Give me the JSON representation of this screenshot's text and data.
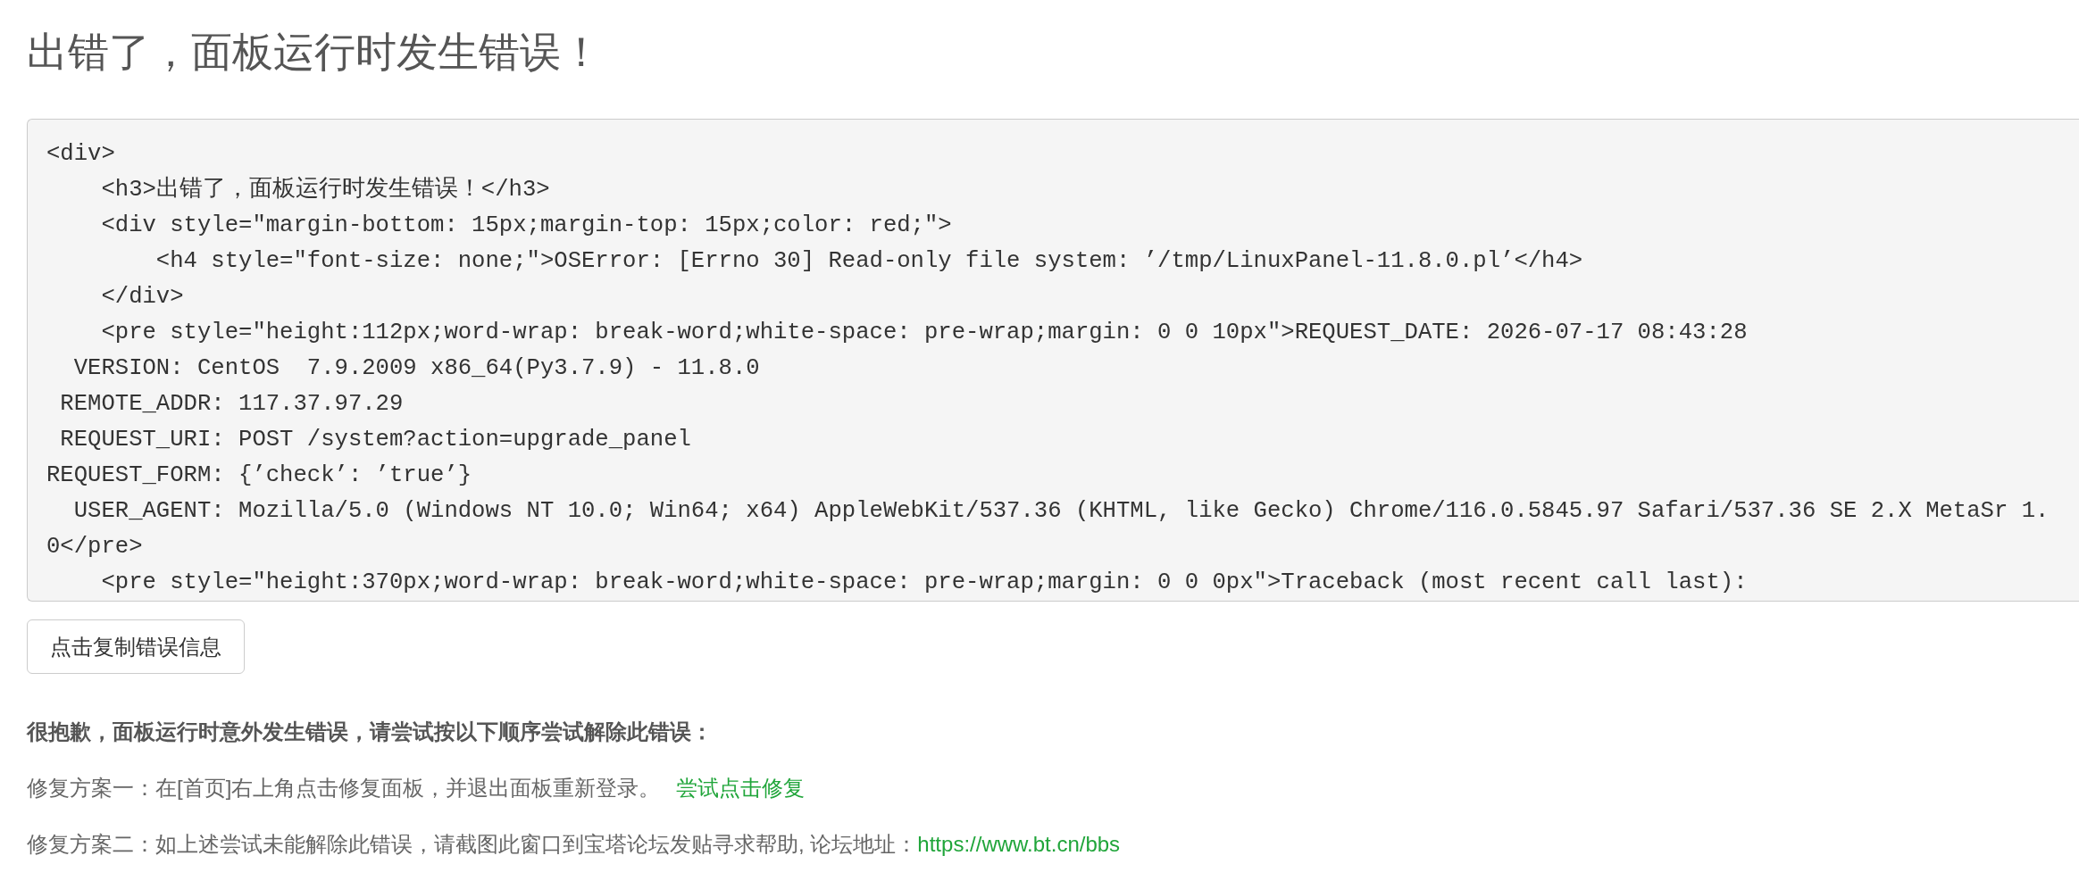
{
  "page": {
    "title": "出错了，面板运行时发生错误！"
  },
  "error_details": {
    "lines": [
      "<div>",
      "    <h3>出错了，面板运行时发生错误！</h3>",
      "    <div style=\"margin-bottom: 15px;margin-top: 15px;color: red;\">",
      "        <h4 style=\"font-size: none;\">OSError: [Errno 30] Read-only file system: ’/tmp/LinuxPanel-11.8.0.pl’</h4>",
      "    </div>",
      "    <pre style=\"height:112px;word-wrap: break-word;white-space: pre-wrap;margin: 0 0 10px\">REQUEST_DATE: 2026-07-17 08:43:28",
      "  VERSION: CentOS  7.9.2009 x86_64(Py3.7.9) - 11.8.0",
      " REMOTE_ADDR: 117.37.97.29",
      " REQUEST_URI: POST /system?action=upgrade_panel",
      "REQUEST_FORM: {’check’: ’true’}",
      "  USER_AGENT: Mozilla/5.0 (Windows NT 10.0; Win64; x64) AppleWebKit/537.36 (KHTML, like Gecko) Chrome/116.0.5845.97 Safari/537.36 SE 2.X MetaSr 1.",
      "0</pre>",
      "    <pre style=\"height:370px;word-wrap: break-word;white-space: pre-wrap;margin: 0 0 0px\">Traceback (most recent call last):"
    ]
  },
  "copy_button": {
    "label": "点击复制错误信息"
  },
  "help": {
    "heading": "很抱歉，面板运行时意外发生错误，请尝试按以下顺序尝试解除此错误：",
    "solutions": [
      {
        "text": "修复方案一：在[首页]右上角点击修复面板，并退出面板重新登录。",
        "link": "尝试点击修复"
      },
      {
        "text": "修复方案二：如上述尝试未能解除此错误，请截图此窗口到宝塔论坛发贴寻求帮助, 论坛地址：",
        "link": "https://www.bt.cn/bbs"
      }
    ]
  }
}
